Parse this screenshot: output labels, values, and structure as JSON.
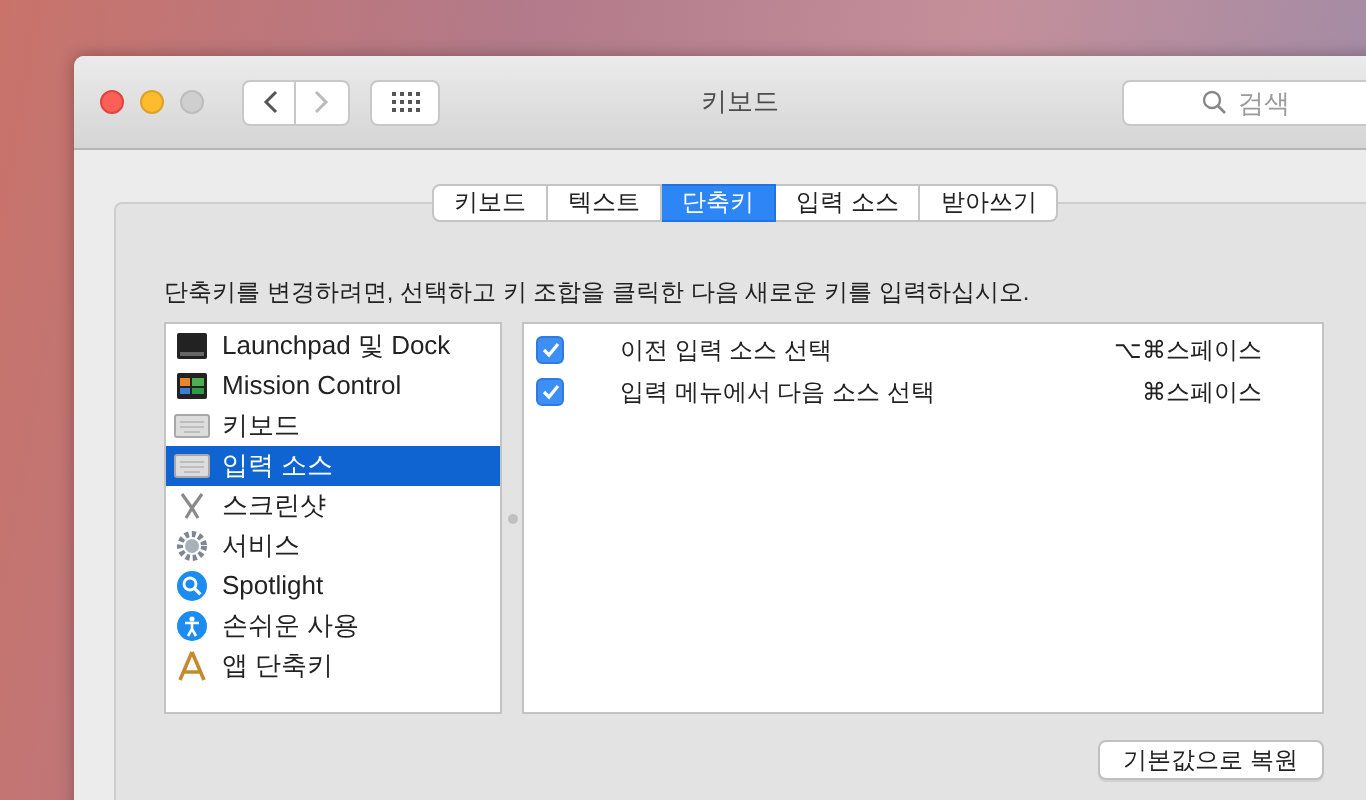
{
  "window": {
    "title": "키보드"
  },
  "toolbar": {
    "search": {
      "placeholder": "검색"
    }
  },
  "tabs": [
    {
      "label": "키보드",
      "selected": false
    },
    {
      "label": "텍스트",
      "selected": false
    },
    {
      "label": "단축키",
      "selected": true
    },
    {
      "label": "입력 소스",
      "selected": false
    },
    {
      "label": "받아쓰기",
      "selected": false
    }
  ],
  "instruction": "단축키를 변경하려면, 선택하고 키 조합을 클릭한 다음 새로운 키를 입력하십시오.",
  "categories": [
    {
      "label": "Launchpad 및 Dock",
      "kind": "launchpad",
      "selected": false
    },
    {
      "label": "Mission Control",
      "kind": "mission",
      "selected": false
    },
    {
      "label": "키보드",
      "kind": "keyboard",
      "selected": false
    },
    {
      "label": "입력 소스",
      "kind": "keyboard",
      "selected": true
    },
    {
      "label": "스크린샷",
      "kind": "screenshot",
      "selected": false
    },
    {
      "label": "서비스",
      "kind": "gear",
      "selected": false
    },
    {
      "label": "Spotlight",
      "kind": "spotlight",
      "selected": false
    },
    {
      "label": "손쉬운 사용",
      "kind": "accessibility",
      "selected": false
    },
    {
      "label": "앱 단축키",
      "kind": "apps",
      "selected": false
    }
  ],
  "shortcuts": [
    {
      "label": "이전 입력 소스 선택",
      "checked": true,
      "keys": "⌥⌘스페이스"
    },
    {
      "label": "입력 메뉴에서 다음 소스 선택",
      "checked": true,
      "keys": "⌘스페이스"
    }
  ],
  "restore_button": "기본값으로 복원"
}
